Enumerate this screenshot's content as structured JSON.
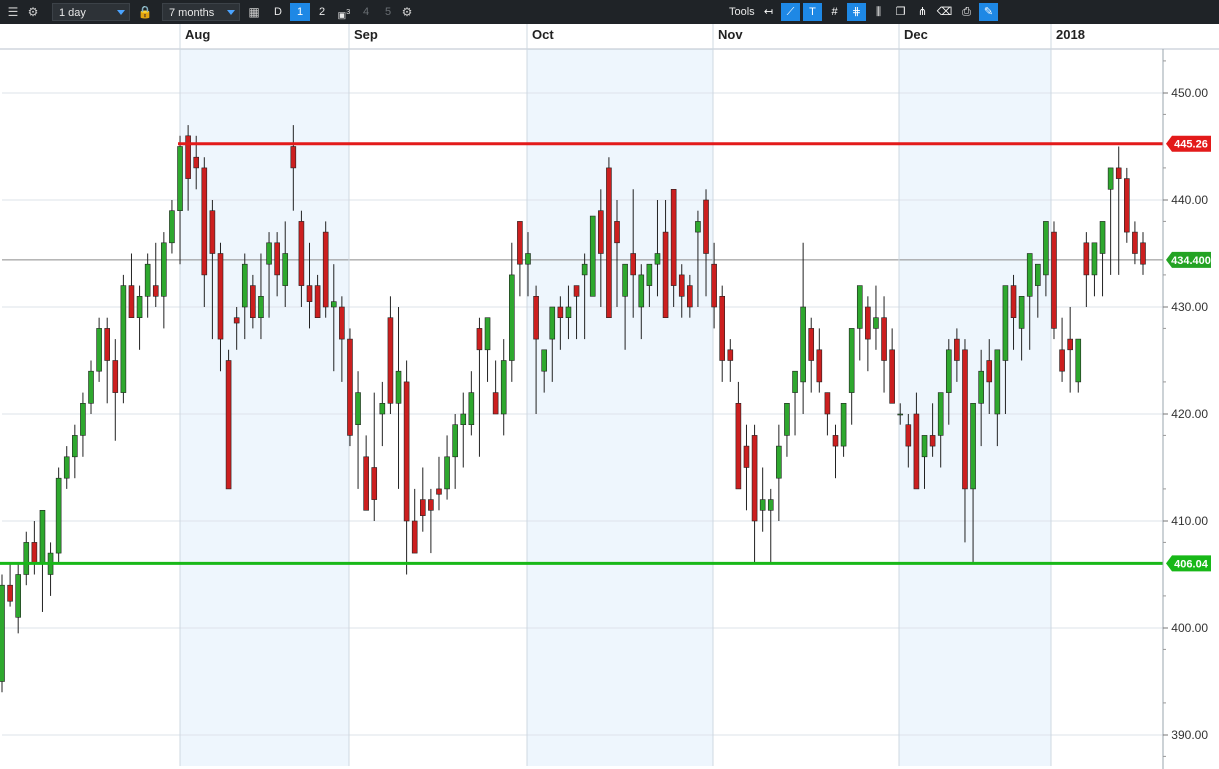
{
  "toolbar": {
    "interval": "1 day",
    "range": "7 months",
    "style_label": "D",
    "layout_buttons": [
      "1",
      "2",
      "3",
      "4",
      "5"
    ],
    "tools_label": "Tools",
    "icons": [
      "menu-icon",
      "settings-icon",
      "lock-icon",
      "calendar-icon",
      "layout-icon",
      "settings-icon",
      "back-arrow-icon",
      "trendline-icon",
      "text-tool-icon",
      "grid-icon",
      "fibonacci-icon",
      "candle-type-icon",
      "duplicate-icon",
      "pitchfork-icon",
      "eraser-icon",
      "print-icon",
      "extra-tools-icon"
    ]
  },
  "chart_data": {
    "type": "candlestick",
    "x_labels": [
      "Aug",
      "Sep",
      "Oct",
      "Nov",
      "Dec",
      "2018"
    ],
    "y_ticks": [
      "390.00",
      "400.00",
      "410.00",
      "420.00",
      "430.00",
      "440.00",
      "450.00"
    ],
    "ylim": [
      388,
      454
    ],
    "current_price": "434.400",
    "resistance": {
      "value": 445.26,
      "label": "445.26",
      "color": "#e31a1a"
    },
    "support": {
      "value": 406.04,
      "label": "406.04",
      "color": "#18b818"
    },
    "colors": {
      "up": "#2ea82e",
      "down": "#cc1f1f",
      "shade": "#eef6fd",
      "grid": "#dde3ea"
    },
    "candles": [
      [
        395,
        405,
        394,
        404
      ],
      [
        404,
        406,
        402,
        402.5
      ],
      [
        401,
        406,
        399.5,
        405
      ],
      [
        405,
        409,
        404,
        408
      ],
      [
        408,
        410,
        405,
        406
      ],
      [
        406,
        411,
        401.5,
        411
      ],
      [
        405,
        408,
        403,
        407
      ],
      [
        407,
        415,
        406,
        414
      ],
      [
        414,
        417,
        413,
        416
      ],
      [
        416,
        419,
        414,
        418
      ],
      [
        418,
        422,
        416,
        421
      ],
      [
        421,
        425,
        420,
        424
      ],
      [
        424,
        429,
        423,
        428
      ],
      [
        428,
        429,
        421,
        425
      ],
      [
        425,
        427,
        417.5,
        422
      ],
      [
        422,
        433,
        421,
        432
      ],
      [
        432,
        435,
        430,
        429
      ],
      [
        429,
        432,
        426,
        431
      ],
      [
        431,
        435,
        429,
        434
      ],
      [
        432,
        436,
        430,
        431
      ],
      [
        431,
        437,
        428,
        436
      ],
      [
        436,
        440,
        435,
        439
      ],
      [
        439,
        446,
        434,
        445
      ],
      [
        446,
        447,
        439,
        442
      ],
      [
        444,
        446,
        441,
        443
      ],
      [
        443,
        444,
        430,
        433
      ],
      [
        439,
        440,
        427,
        435
      ],
      [
        435,
        436,
        424,
        427
      ],
      [
        425,
        426,
        413,
        413
      ],
      [
        429,
        430,
        426,
        428.5
      ],
      [
        430,
        435,
        427,
        434
      ],
      [
        432,
        433,
        428,
        429
      ],
      [
        429,
        435,
        427,
        431
      ],
      [
        434,
        437,
        429,
        436
      ],
      [
        436,
        437,
        431,
        433
      ],
      [
        432,
        438,
        430,
        435
      ],
      [
        445,
        447,
        439,
        443
      ],
      [
        438,
        439,
        430,
        432
      ],
      [
        432,
        436,
        428,
        430.5
      ],
      [
        432,
        433,
        430,
        429
      ],
      [
        437,
        438,
        429,
        430
      ],
      [
        430,
        434,
        424,
        430.5
      ],
      [
        430,
        431,
        423,
        427
      ],
      [
        427,
        428,
        417,
        418
      ],
      [
        419,
        424,
        413,
        422
      ],
      [
        416,
        418,
        411,
        411
      ],
      [
        415,
        422,
        410,
        412
      ],
      [
        420,
        423,
        417,
        421
      ],
      [
        429,
        431,
        420,
        421
      ],
      [
        421,
        430,
        413,
        424
      ],
      [
        423,
        425,
        405,
        410
      ],
      [
        410,
        413,
        407.5,
        407
      ],
      [
        412,
        415,
        409,
        410.5
      ],
      [
        412,
        413,
        407,
        411
      ],
      [
        413,
        416,
        411,
        412.5
      ],
      [
        413,
        418,
        412,
        416
      ],
      [
        416,
        420,
        413,
        419
      ],
      [
        419,
        422,
        415,
        420
      ],
      [
        419,
        424,
        418,
        422
      ],
      [
        428,
        429,
        416,
        426
      ],
      [
        426,
        429,
        423,
        429
      ],
      [
        422,
        425,
        420,
        420
      ],
      [
        420,
        427,
        418,
        425
      ],
      [
        425,
        436,
        423,
        433
      ],
      [
        438,
        438,
        431,
        434
      ],
      [
        434,
        437,
        431,
        435
      ],
      [
        431,
        432,
        420,
        427
      ],
      [
        424,
        426,
        422,
        426
      ],
      [
        427,
        430,
        423,
        430
      ],
      [
        430,
        431,
        426,
        429
      ],
      [
        429,
        432,
        427,
        430
      ],
      [
        432,
        432,
        427,
        431
      ],
      [
        433,
        435,
        427,
        434
      ],
      [
        431,
        436,
        431,
        438.5
      ],
      [
        439,
        441,
        430,
        435
      ],
      [
        443,
        444,
        429,
        429
      ],
      [
        438,
        440,
        430,
        436
      ],
      [
        431,
        434,
        426,
        434
      ],
      [
        435,
        441,
        429,
        433
      ],
      [
        430,
        434,
        427,
        433
      ],
      [
        432,
        433,
        430,
        434
      ],
      [
        434,
        440,
        431,
        435
      ],
      [
        437,
        440,
        429,
        429
      ],
      [
        441,
        441,
        430,
        432
      ],
      [
        433,
        434,
        429,
        431
      ],
      [
        432,
        433,
        429,
        430
      ],
      [
        437,
        439,
        430,
        438
      ],
      [
        440,
        441,
        431,
        435
      ],
      [
        434,
        436,
        428,
        430
      ],
      [
        431,
        432,
        423,
        425
      ],
      [
        426,
        427,
        423,
        425
      ],
      [
        421,
        423,
        413,
        413
      ],
      [
        417,
        419,
        411,
        415
      ],
      [
        418,
        419,
        406,
        410
      ],
      [
        411,
        415,
        409,
        412
      ],
      [
        411,
        413,
        406,
        412
      ],
      [
        414,
        419,
        410,
        417
      ],
      [
        418,
        420,
        416,
        421
      ],
      [
        422,
        424,
        418,
        424
      ],
      [
        423,
        436,
        420,
        430
      ],
      [
        428,
        429,
        422,
        425
      ],
      [
        426,
        428,
        422,
        423
      ],
      [
        422,
        422,
        418,
        420
      ],
      [
        418,
        419,
        414,
        417
      ],
      [
        417,
        421,
        416,
        421
      ],
      [
        422,
        426,
        419,
        428
      ],
      [
        428,
        430,
        425,
        432
      ],
      [
        430,
        431,
        424,
        427
      ],
      [
        428,
        432,
        426,
        429
      ],
      [
        429,
        431,
        422,
        425
      ],
      [
        426,
        428,
        422,
        421
      ],
      [
        420,
        421,
        419,
        420
      ],
      [
        419,
        420,
        415,
        417
      ],
      [
        420,
        422,
        414,
        413
      ],
      [
        416,
        418,
        413,
        418
      ],
      [
        418,
        421,
        416,
        417
      ],
      [
        418,
        422,
        415,
        422
      ],
      [
        422,
        427,
        419,
        426
      ],
      [
        427,
        428,
        423,
        425
      ],
      [
        426,
        427,
        408,
        413
      ],
      [
        413,
        419,
        406,
        421
      ],
      [
        421,
        426,
        417,
        424
      ],
      [
        425,
        427,
        420,
        423
      ],
      [
        420,
        424,
        417,
        426
      ],
      [
        425,
        431,
        420,
        432
      ],
      [
        432,
        433,
        426,
        429
      ],
      [
        428,
        430,
        425,
        431
      ],
      [
        431,
        433,
        426,
        435
      ],
      [
        432,
        434,
        429,
        434
      ],
      [
        433,
        437,
        431,
        438
      ],
      [
        437,
        438,
        427,
        428
      ],
      [
        426,
        429,
        423,
        424
      ],
      [
        427,
        430,
        422,
        426
      ],
      [
        423,
        425,
        422,
        427
      ],
      [
        436,
        437,
        430,
        433
      ],
      [
        433,
        436,
        431,
        436
      ],
      [
        435,
        437,
        431,
        438
      ],
      [
        441,
        443,
        433,
        443
      ],
      [
        443,
        445,
        433,
        442
      ],
      [
        442,
        443,
        436,
        437
      ],
      [
        437,
        438,
        434,
        435
      ],
      [
        436,
        437,
        433,
        434
      ]
    ]
  }
}
